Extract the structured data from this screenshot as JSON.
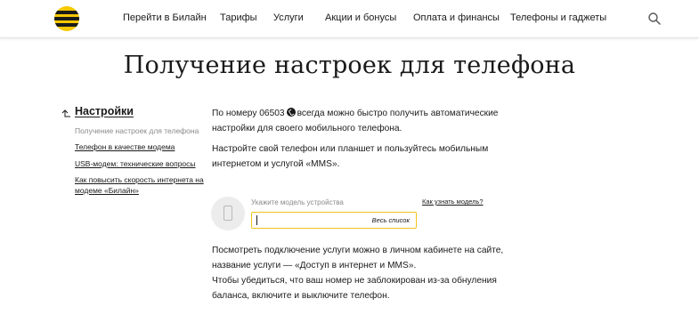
{
  "header": {
    "nav": [
      {
        "label": "Перейти в Билайн"
      },
      {
        "label": "Тарифы"
      },
      {
        "label": "Услуги"
      },
      {
        "label": "Акции и бонусы"
      },
      {
        "label": "Оплата и финансы"
      },
      {
        "label": "Телефоны и гаджеты"
      }
    ],
    "search_icon": "search-icon",
    "colors": {
      "brand_yellow": "#f6c800",
      "brand_black": "#1b1b1b"
    }
  },
  "page": {
    "title": "Получение настроек для телефона"
  },
  "sidebar": {
    "title": "Настройки",
    "items": [
      {
        "label": "Получение настроек для телефона"
      },
      {
        "label": "Телефон в качестве модема"
      },
      {
        "label": "USB-модем: технические вопросы"
      },
      {
        "label_line1": "Как повысить скорость интернета на",
        "label_line2": "модеме «Билайн»"
      }
    ]
  },
  "main": {
    "p1_line1_a": "По номеру 06503",
    "p1_line1_b": "всегда можно быстро получить автоматические",
    "p1_line2": "настройки для своего мобильного телефона.",
    "p2_line1": "Настройте свой телефон или планшет и пользуйтесь мобильным",
    "p2_line2": "интернетом и услугой «MMS».",
    "device_label": "Укажите модель устройства",
    "how_link": "Как узнать модель?",
    "all_list": "Весь список",
    "input_value": "",
    "p3_line1": "Посмотреть подключение услуги можно в личном кабинете на сайте,",
    "p3_line2": "название услуги — «Доступ в интернет и MMS».",
    "p3_line3": "Чтобы убедиться, что ваш номер не заблокирован из-за обнуления",
    "p3_line4": "баланса, включите и выключите телефон.",
    "accent_color": "#f0c419"
  }
}
